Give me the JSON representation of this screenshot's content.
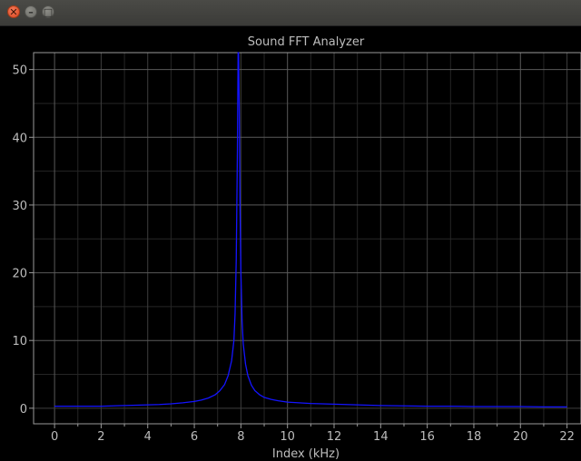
{
  "window": {
    "buttons": {
      "close": "✕",
      "minimize": "–",
      "maximize": "□"
    }
  },
  "chart_data": {
    "type": "line",
    "title": "Sound FFT Analyzer",
    "xlabel": "Index (kHz)",
    "ylabel": "",
    "xlim": [
      -0.9,
      22.6
    ],
    "ylim": [
      -2.3,
      52.5
    ],
    "x_ticks": [
      0,
      2,
      4,
      6,
      8,
      10,
      12,
      14,
      16,
      18,
      20,
      22
    ],
    "y_ticks": [
      0,
      10,
      20,
      30,
      40,
      50
    ],
    "grid": true,
    "line_color": "#1414ff",
    "series": [
      {
        "x": [
          0,
          0.5,
          1,
          1.5,
          2,
          2.5,
          3,
          3.5,
          4,
          4.5,
          5,
          5.5,
          6,
          6.3,
          6.6,
          6.9,
          7.1,
          7.3,
          7.45,
          7.6,
          7.7,
          7.75,
          7.8,
          7.85,
          7.88,
          7.9,
          7.93,
          7.96,
          8.0,
          8.05,
          8.1,
          8.2,
          8.3,
          8.45,
          8.6,
          8.8,
          9.0,
          9.3,
          9.6,
          10,
          10.5,
          11,
          11.5,
          12,
          12.5,
          13,
          13.5,
          14,
          15,
          16,
          17,
          18,
          19,
          20,
          21,
          22
        ],
        "y": [
          0.3,
          0.3,
          0.3,
          0.3,
          0.3,
          0.35,
          0.4,
          0.45,
          0.5,
          0.55,
          0.65,
          0.8,
          1.0,
          1.2,
          1.5,
          2.0,
          2.6,
          3.5,
          4.8,
          7.0,
          10.0,
          14.0,
          22.0,
          38.0,
          52.5,
          52.5,
          44.0,
          30.0,
          20.0,
          13.0,
          9.5,
          6.5,
          4.8,
          3.4,
          2.6,
          2.0,
          1.6,
          1.3,
          1.1,
          0.9,
          0.8,
          0.7,
          0.65,
          0.6,
          0.55,
          0.5,
          0.45,
          0.4,
          0.35,
          0.3,
          0.3,
          0.25,
          0.25,
          0.25,
          0.2,
          0.2
        ]
      }
    ]
  }
}
